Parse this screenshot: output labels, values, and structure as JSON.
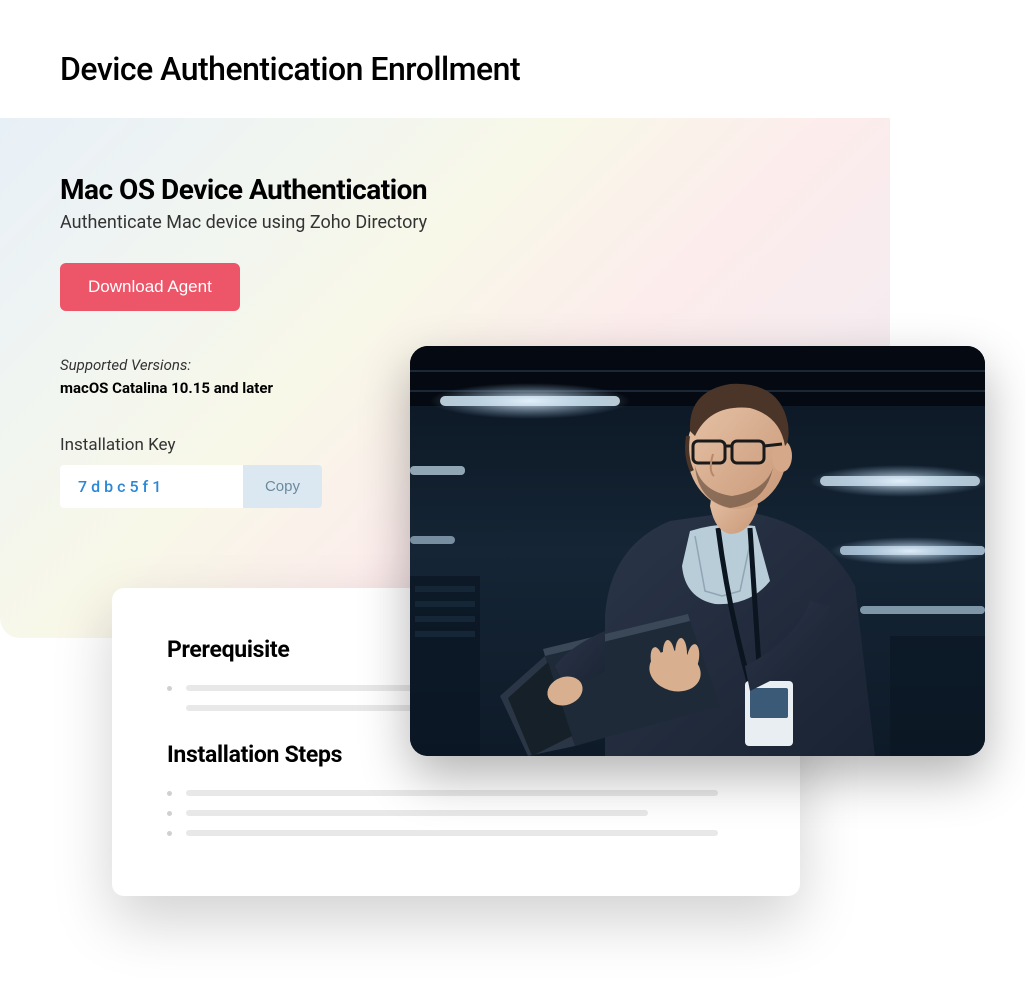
{
  "page": {
    "title": "Device Authentication Enrollment"
  },
  "auth": {
    "title": "Mac OS Device Authentication",
    "subtitle": "Authenticate Mac device using Zoho Directory",
    "download_button": "Download Agent",
    "supported_label": "Supported Versions:",
    "supported_value": "macOS Catalina 10.15 and later",
    "install_key_label": "Installation Key",
    "install_key_value": "7dbc5f1",
    "copy_button": "Copy"
  },
  "sections": {
    "prerequisite_title": "Prerequisite",
    "steps_title": "Installation Steps"
  }
}
